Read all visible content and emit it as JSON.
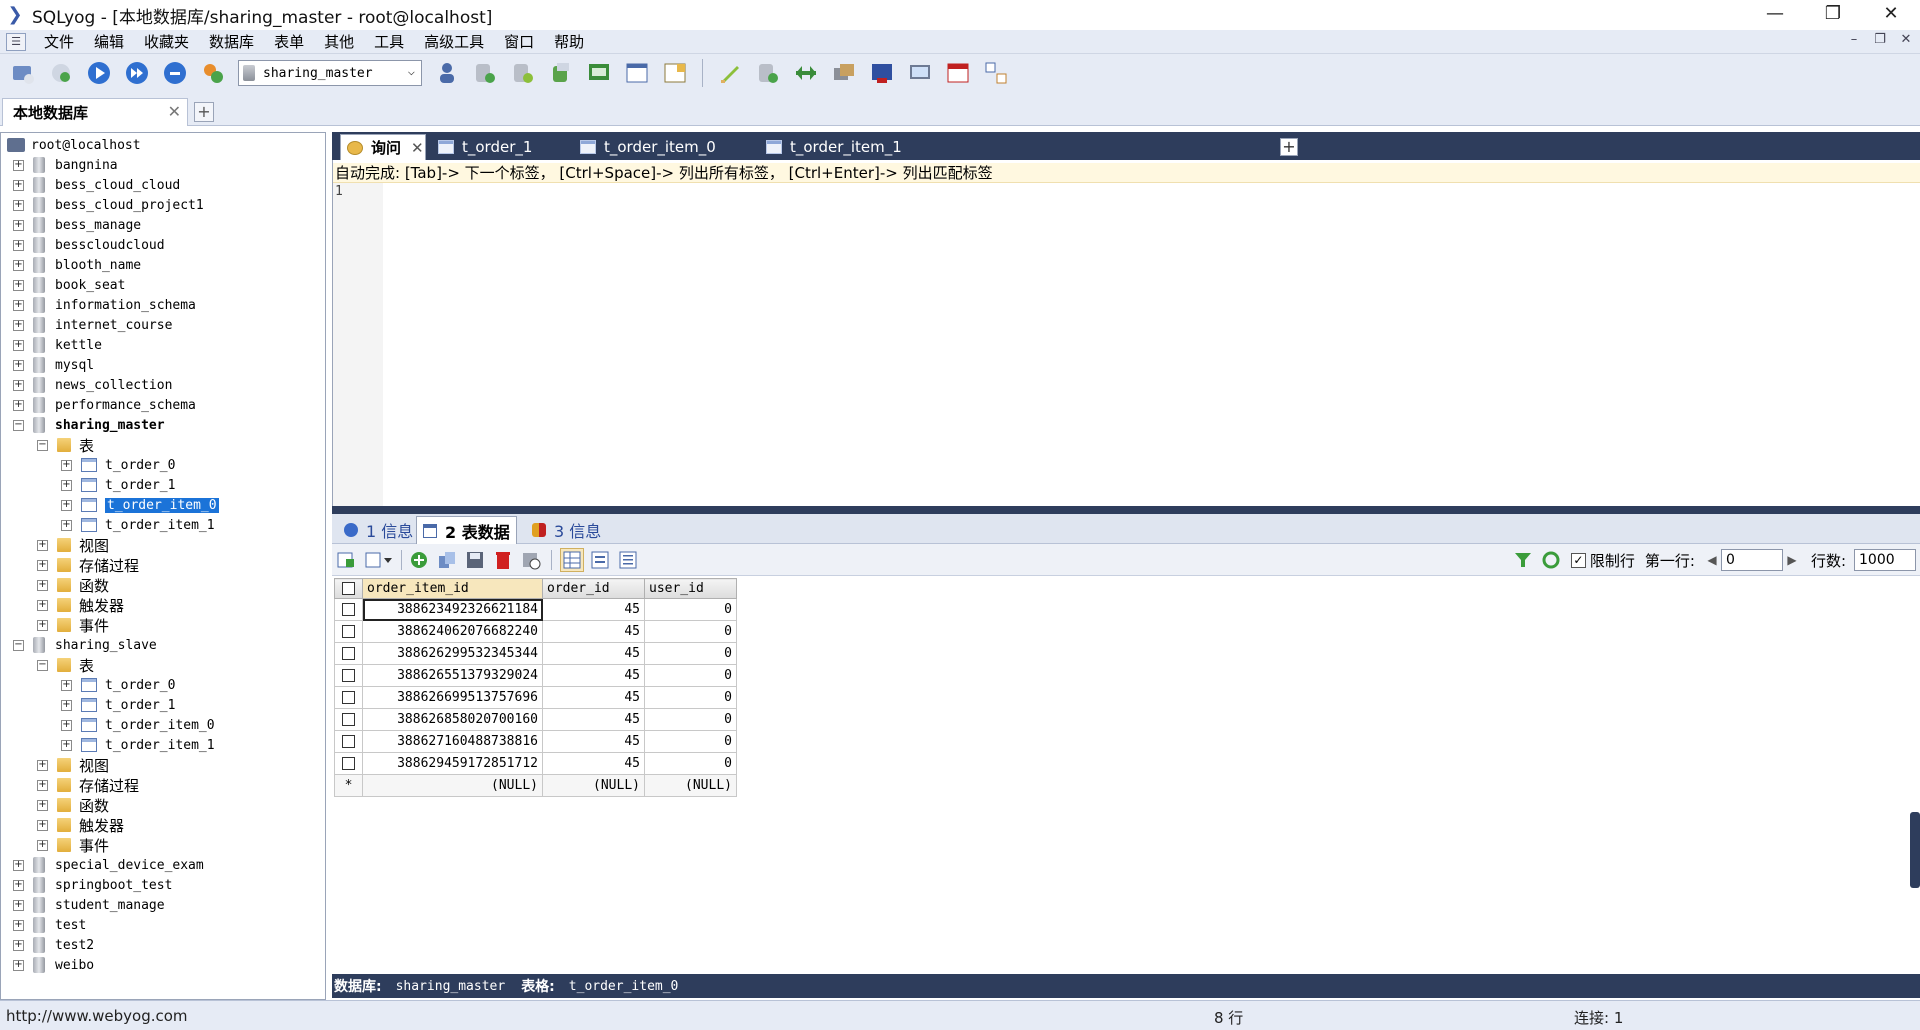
{
  "window": {
    "title": "SQLyog - [本地数据库/sharing_master - root@localhost]",
    "controls": [
      "—",
      "❐",
      "✕"
    ]
  },
  "menu": {
    "items": [
      "文件",
      "编辑",
      "收藏夹",
      "数据库",
      "表单",
      "其他",
      "工具",
      "高级工具",
      "窗口",
      "帮助"
    ],
    "mdi_controls": [
      "–",
      "❐",
      "✕"
    ]
  },
  "toolbar": {
    "database_select": "sharing_master"
  },
  "connection_tab": {
    "label": "本地数据库",
    "close": "✕",
    "add": "+"
  },
  "tree": {
    "root": "root@localhost",
    "databases_top": [
      "bangnina",
      "bess_cloud_cloud",
      "bess_cloud_project1",
      "bess_manage",
      "besscloudcloud",
      "blooth_name",
      "book_seat",
      "information_schema",
      "internet_course",
      "kettle",
      "mysql",
      "news_collection",
      "performance_schema"
    ],
    "master": {
      "name": "sharing_master",
      "tables_label": "表",
      "tables": [
        "t_order_0",
        "t_order_1",
        "t_order_item_0",
        "t_order_item_1"
      ],
      "folders": [
        "视图",
        "存储过程",
        "函数",
        "触发器",
        "事件"
      ]
    },
    "slave": {
      "name": "sharing_slave",
      "tables_label": "表",
      "tables": [
        "t_order_0",
        "t_order_1",
        "t_order_item_0",
        "t_order_item_1"
      ],
      "folders": [
        "视图",
        "存储过程",
        "函数",
        "触发器",
        "事件"
      ]
    },
    "databases_bottom": [
      "special_device_exam",
      "springboot_test",
      "student_manage",
      "test",
      "test2",
      "weibo"
    ]
  },
  "query_tabs": [
    {
      "label": "询问",
      "close": "✕"
    },
    {
      "label": "t_order_1"
    },
    {
      "label": "t_order_item_0"
    },
    {
      "label": "t_order_item_1"
    }
  ],
  "query_tab_add": "+",
  "editor": {
    "hint": "自动完成:  [Tab]-> 下一个标签，  [Ctrl+Space]-> 列出所有标签，  [Ctrl+Enter]-> 列出匹配标签",
    "line_number": "1"
  },
  "result_tabs": [
    {
      "label": "1 信息"
    },
    {
      "label": "2 表数据"
    },
    {
      "label": "3 信息"
    }
  ],
  "grid_toolbar": {
    "limit_label": "限制行",
    "limit_checked": "✓",
    "first_row_label": "第一行:",
    "first_row_value": "0",
    "rows_label": "行数:",
    "rows_value": "1000"
  },
  "grid": {
    "columns": [
      "order_item_id",
      "order_id",
      "user_id"
    ],
    "rows": [
      [
        "388623492326621184",
        "45",
        "0"
      ],
      [
        "388624062076682240",
        "45",
        "0"
      ],
      [
        "388626299532345344",
        "45",
        "0"
      ],
      [
        "388626551379329024",
        "45",
        "0"
      ],
      [
        "388626699513757696",
        "45",
        "0"
      ],
      [
        "388626858020700160",
        "45",
        "0"
      ],
      [
        "388627160488738816",
        "45",
        "0"
      ],
      [
        "388629459172851712",
        "45",
        "0"
      ]
    ],
    "new_row_marker": "*",
    "null_text": "(NULL)"
  },
  "info_bar": {
    "db_label": "数据库:",
    "db_value": "sharing_master",
    "table_label": "表格:",
    "table_value": "t_order_item_0"
  },
  "statusbar": {
    "url": "http://www.webyog.com",
    "rows": "8 行",
    "connection": "连接: 1"
  }
}
